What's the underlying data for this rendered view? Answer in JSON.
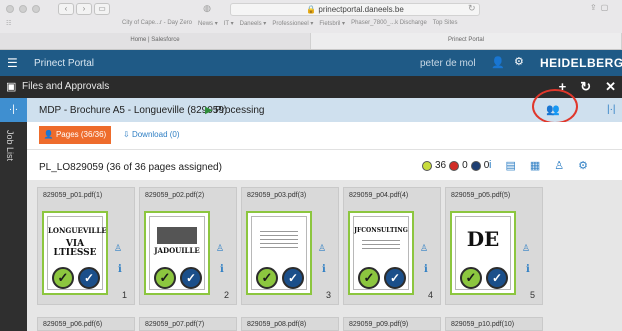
{
  "browser": {
    "url": "prinectportal.daneels.be",
    "bookmarks": [
      "City of Cape...r - Day Zero",
      "News ▾",
      "IT ▾",
      "Daneels ▾",
      "Professioneel ▾",
      "Fietsbril ▾",
      "Phaser_7800_...k Discharge",
      "Top Sites"
    ],
    "tabs": [
      "Home | Salesforce",
      "Prinect Portal"
    ]
  },
  "app": {
    "title": "Prinect Portal",
    "user": "peter de mol",
    "logo": "HEIDELBERG",
    "section": "Files and Approvals"
  },
  "rail": {
    "label": "Job List"
  },
  "job": {
    "title": "MDP - Brochure A5 - Longueville (829059)",
    "status": "Processing"
  },
  "tabs": {
    "pages": "Pages (36/36)",
    "download": "Download (0)"
  },
  "assignment": {
    "text": "PL_LO829059 (36 of 36 pages assigned)",
    "green_count": "36",
    "red_count": "0",
    "blue_count": "0"
  },
  "pages": [
    {
      "name": "829059_p01.pdf(1)",
      "number": "1"
    },
    {
      "name": "829059_p02.pdf(2)",
      "number": "2"
    },
    {
      "name": "829059_p03.pdf(3)",
      "number": "3"
    },
    {
      "name": "829059_p04.pdf(4)",
      "number": "4"
    },
    {
      "name": "829059_p05.pdf(5)",
      "number": "5"
    }
  ],
  "pages_row2": [
    "829059_p06.pdf(6)",
    "829059_p07.pdf(7)",
    "829059_p08.pdf(8)",
    "829059_p09.pdf(9)",
    "829059_p10.pdf(10)"
  ],
  "thumbs": {
    "p1_line1": "LONGUEVILLE",
    "p1_line2": "VIA LTIESSE",
    "p2_line1": "JADOUILLE",
    "p4_line1": "JFCONSULTING",
    "p5_line1": "DE"
  },
  "colors": {
    "appbar": "#1f5a86",
    "accent_orange": "#ee6c2c",
    "approved_green": "#8cc63f",
    "link_blue": "#2f7fc4",
    "highlight_red": "#e0372b"
  },
  "icons": {
    "menu": "hamburger-icon",
    "user": "user-icon",
    "settings": "gear-icon",
    "add": "plus-icon",
    "refresh": "refresh-icon",
    "close": "close-icon"
  }
}
